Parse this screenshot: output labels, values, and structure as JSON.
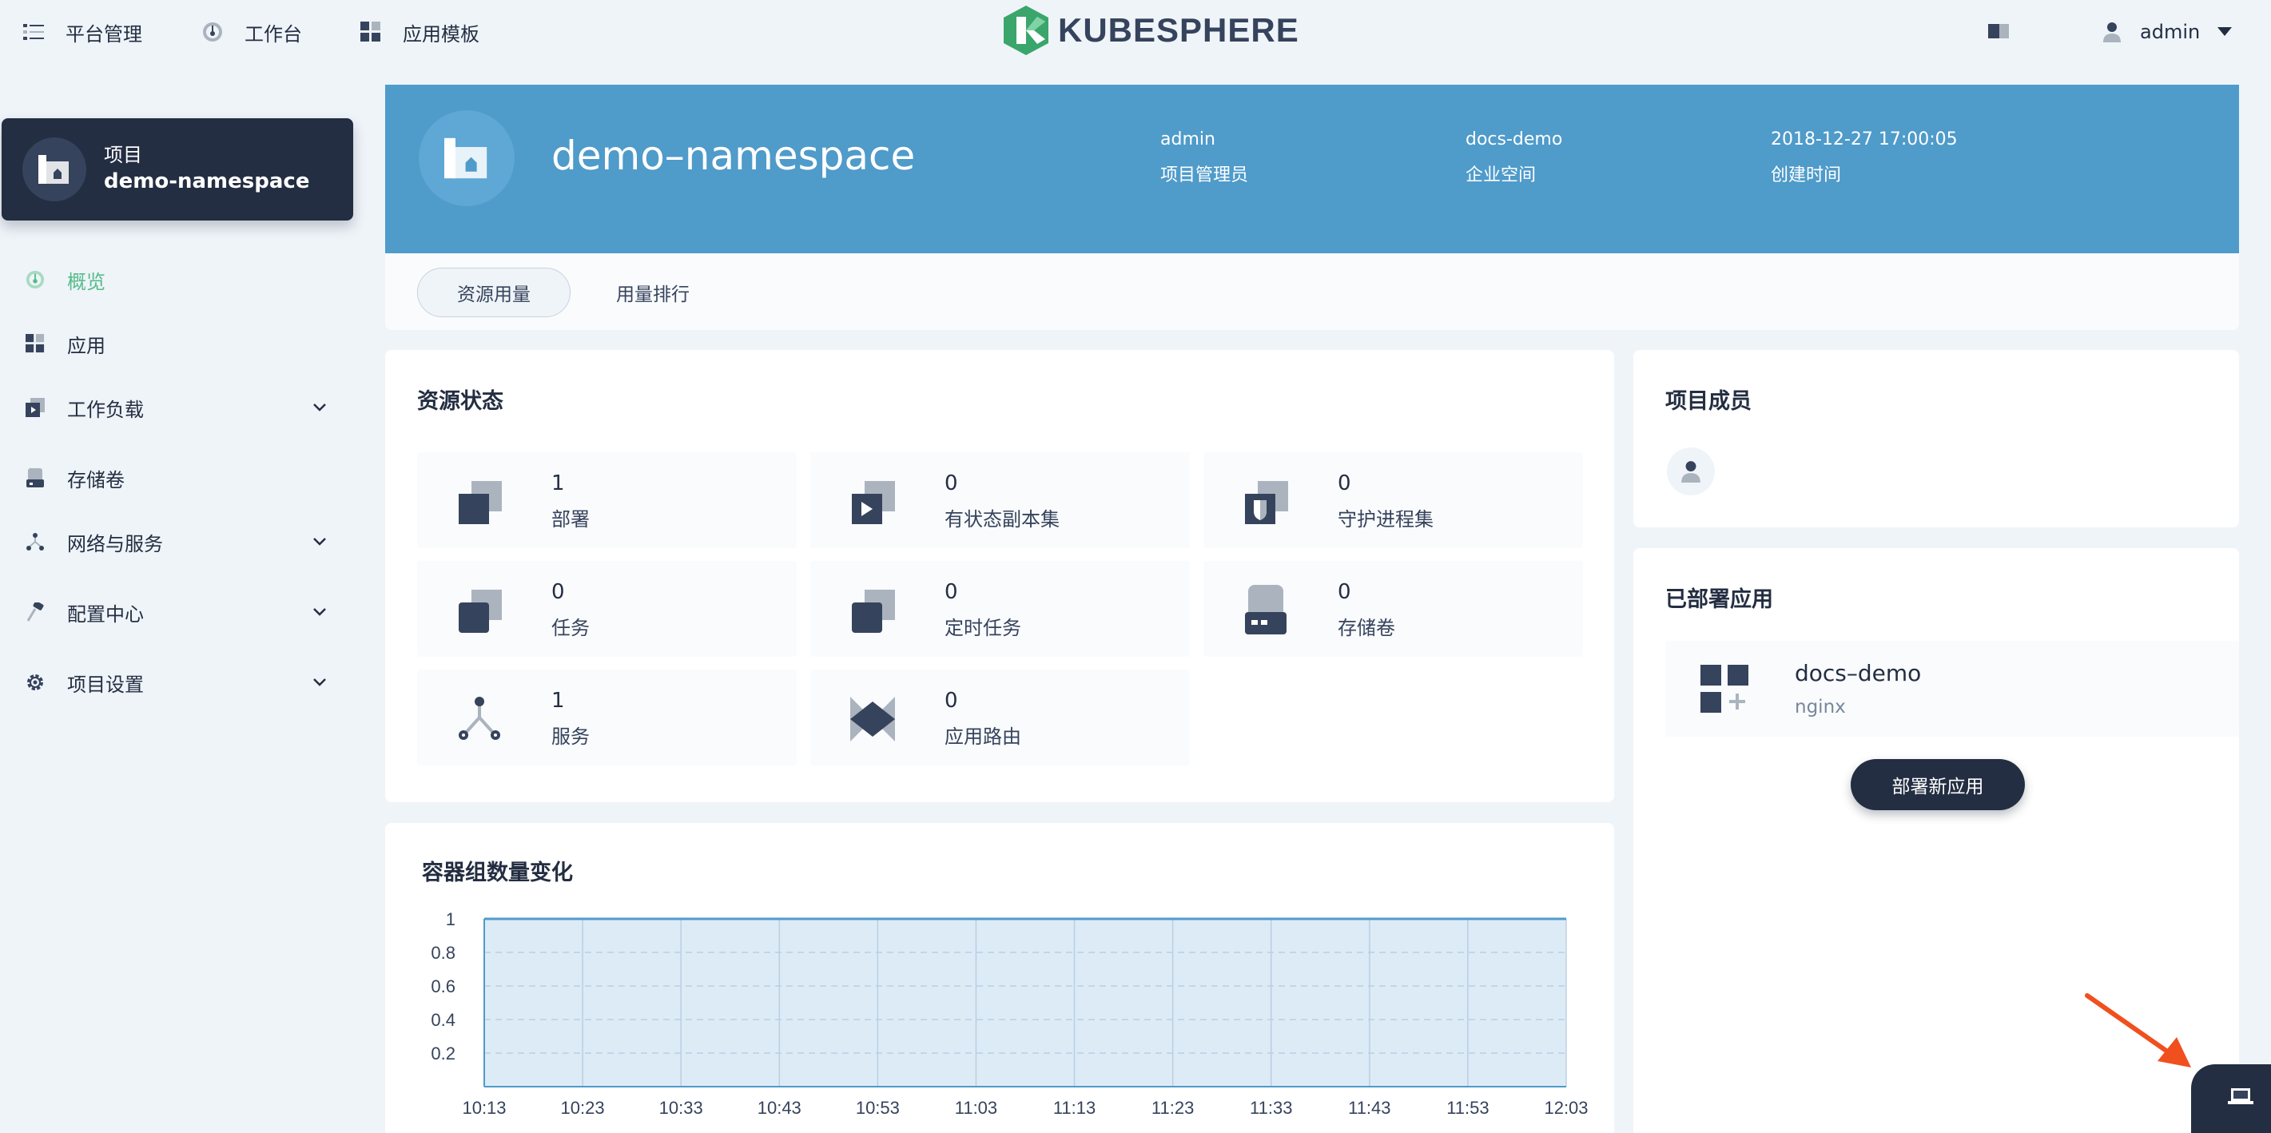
{
  "topnav": {
    "platform_label": "平台管理",
    "workbench_label": "工作台",
    "templates_label": "应用模板",
    "brand": "KUBESPHERE",
    "user": "admin"
  },
  "sidebar": {
    "project_type": "项目",
    "project_name": "demo-namespace",
    "items": [
      {
        "label": "概览",
        "icon": "dashboard-icon",
        "active": true
      },
      {
        "label": "应用",
        "icon": "apps-icon"
      },
      {
        "label": "工作负载",
        "icon": "workload-icon",
        "expandable": true
      },
      {
        "label": "存储卷",
        "icon": "storage-icon"
      },
      {
        "label": "网络与服务",
        "icon": "network-icon",
        "expandable": true
      },
      {
        "label": "配置中心",
        "icon": "config-icon",
        "expandable": true
      },
      {
        "label": "项目设置",
        "icon": "settings-icon",
        "expandable": true
      }
    ]
  },
  "banner": {
    "title": "demo–namespace",
    "meta": [
      {
        "value": "admin",
        "label": "项目管理员"
      },
      {
        "value": "docs-demo",
        "label": "企业空间"
      },
      {
        "value": "2018-12-27 17:00:05",
        "label": "创建时间"
      }
    ]
  },
  "tabs": [
    "资源用量",
    "用量排行"
  ],
  "resource_status": {
    "title": "资源状态",
    "tiles": [
      {
        "count": "1",
        "label": "部署",
        "icon": "deployment-icon"
      },
      {
        "count": "0",
        "label": "有状态副本集",
        "icon": "statefulset-icon"
      },
      {
        "count": "0",
        "label": "守护进程集",
        "icon": "daemonset-icon"
      },
      {
        "count": "0",
        "label": "任务",
        "icon": "job-icon"
      },
      {
        "count": "0",
        "label": "定时任务",
        "icon": "cronjob-icon"
      },
      {
        "count": "0",
        "label": "存储卷",
        "icon": "volume-icon"
      },
      {
        "count": "1",
        "label": "服务",
        "icon": "service-icon"
      },
      {
        "count": "0",
        "label": "应用路由",
        "icon": "ingress-icon"
      }
    ]
  },
  "members": {
    "title": "项目成员"
  },
  "deployed_apps": {
    "title": "已部署应用",
    "apps": [
      {
        "name": "docs–demo",
        "desc": "nginx"
      }
    ],
    "deploy_button": "部署新应用"
  },
  "pod_chart": {
    "title": "容器组数量变化",
    "chart_data": {
      "type": "area",
      "x": [
        "10:13",
        "10:23",
        "10:33",
        "10:43",
        "10:53",
        "11:03",
        "11:13",
        "11:23",
        "11:33",
        "11:43",
        "11:53",
        "12:03"
      ],
      "y": [
        1,
        1,
        1,
        1,
        1,
        1,
        1,
        1,
        1,
        1,
        1,
        1
      ],
      "yticks": [
        "1",
        "0.8",
        "0.6",
        "0.4",
        "0.2"
      ],
      "ylim": [
        0,
        1
      ],
      "grid": true
    }
  },
  "colors": {
    "primary": "#242e42",
    "banner": "#4f9bca",
    "accent": "#55bc8a",
    "arrow": "#f0501e"
  }
}
